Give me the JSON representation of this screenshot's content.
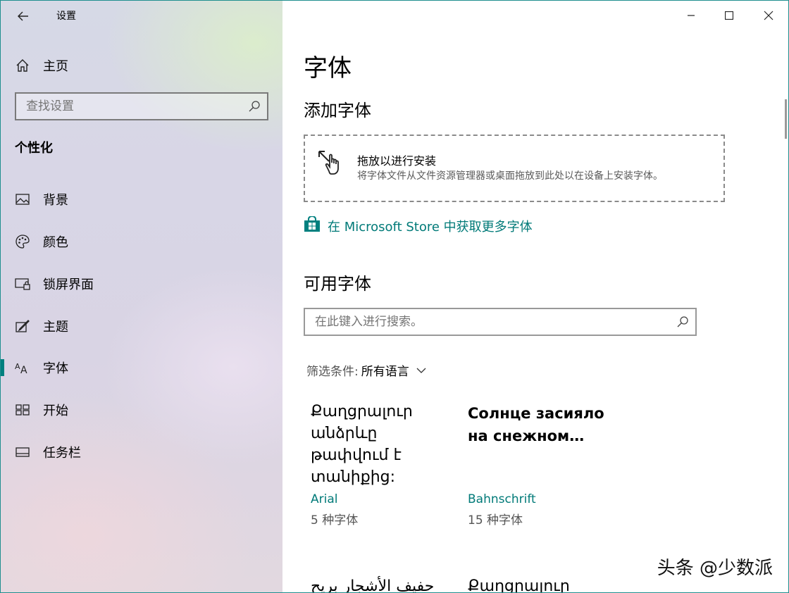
{
  "app": {
    "title": "设置"
  },
  "sidebar": {
    "home_label": "主页",
    "search": {
      "placeholder": "查找设置"
    },
    "section_title": "个性化",
    "items": [
      {
        "label": "背景",
        "icon": "picture-icon"
      },
      {
        "label": "颜色",
        "icon": "palette-icon"
      },
      {
        "label": "锁屏界面",
        "icon": "lock-screen-icon"
      },
      {
        "label": "主题",
        "icon": "theme-icon"
      },
      {
        "label": "字体",
        "icon": "font-icon",
        "active": true
      },
      {
        "label": "开始",
        "icon": "start-icon"
      },
      {
        "label": "任务栏",
        "icon": "taskbar-icon"
      }
    ]
  },
  "main": {
    "page_title": "字体",
    "add_fonts": {
      "heading": "添加字体",
      "drop_title": "拖放以进行安装",
      "drop_subtitle": "将字体文件从文件资源管理器或桌面拖放到此处以在设备上安装字体。"
    },
    "store_link": "在 Microsoft Store 中获取更多字体",
    "available": {
      "heading": "可用字体",
      "search_placeholder": "在此键入进行搜索。",
      "filter_label": "筛选条件:",
      "filter_value": "所有语言"
    },
    "fonts": [
      {
        "sample": "Քաղցրալուր անձրևը թափվում է տանիքից:",
        "name": "Arial",
        "count": "5 种字体"
      },
      {
        "sample": "Солнце засияло на снежном…",
        "name": "Bahnschrift",
        "count": "15 种字体"
      },
      {
        "sample": "حفيف الأشجار بريح"
      },
      {
        "sample": "Քաղցրալուր"
      }
    ]
  },
  "watermark": "头条 @少数派",
  "colors": {
    "accent": "#00807f",
    "link": "#007a78"
  }
}
